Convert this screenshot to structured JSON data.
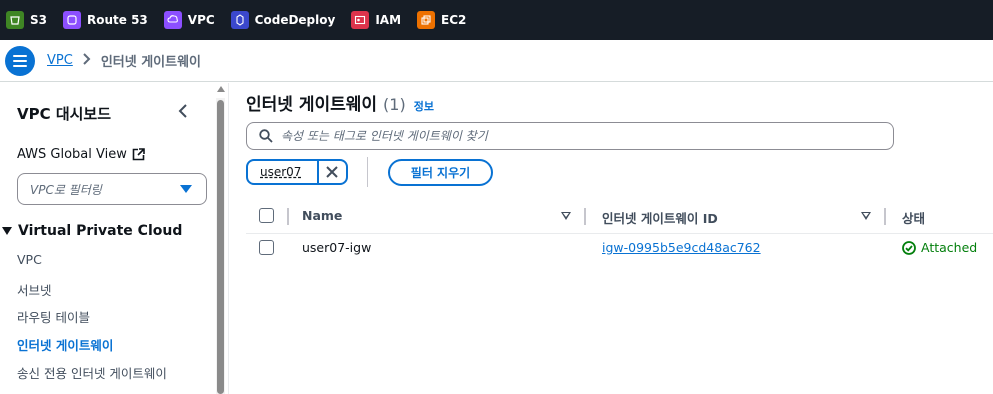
{
  "favorites": [
    {
      "label": "S3",
      "icon": "s3-icon",
      "color": "#3f8624"
    },
    {
      "label": "Route 53",
      "icon": "route53-icon",
      "color": "#8c4fff"
    },
    {
      "label": "VPC",
      "icon": "vpc-icon",
      "color": "#8c4fff"
    },
    {
      "label": "CodeDeploy",
      "icon": "codedeploy-icon",
      "color": "#3b48cc"
    },
    {
      "label": "IAM",
      "icon": "iam-icon",
      "color": "#dd344c"
    },
    {
      "label": "EC2",
      "icon": "ec2-icon",
      "color": "#ed7100"
    }
  ],
  "breadcrumb": {
    "link": "VPC",
    "separator": ">",
    "current": "인터넷 게이트웨이"
  },
  "sidebar": {
    "title": "VPC 대시보드",
    "global_view": "AWS Global View",
    "filter_placeholder": "VPC로 필터링",
    "section": "Virtual Private Cloud",
    "items": [
      {
        "label": "VPC",
        "active": false
      },
      {
        "label": "서브넷",
        "active": false
      },
      {
        "label": "라우팅 테이블",
        "active": false
      },
      {
        "label": "인터넷 게이트웨이",
        "active": true
      },
      {
        "label": "송신 전용 인터넷 게이트웨이",
        "active": false
      }
    ]
  },
  "main": {
    "title": "인터넷 게이트웨이",
    "count": "(1)",
    "info": "정보",
    "search_placeholder": "속성 또는 태그로 인터넷 게이트웨이 찾기",
    "filter_token": "user07",
    "clear_filters": "필터 지우기"
  },
  "table": {
    "columns": [
      "Name",
      "인터넷 게이트웨이 ID",
      "상태"
    ],
    "rows": [
      {
        "name": "user07-igw",
        "id": "igw-0995b5e9cd48ac762",
        "status": "Attached"
      }
    ]
  },
  "colors": {
    "accent": "#0972d3",
    "success": "#037f0c",
    "topbar": "#161d26"
  }
}
